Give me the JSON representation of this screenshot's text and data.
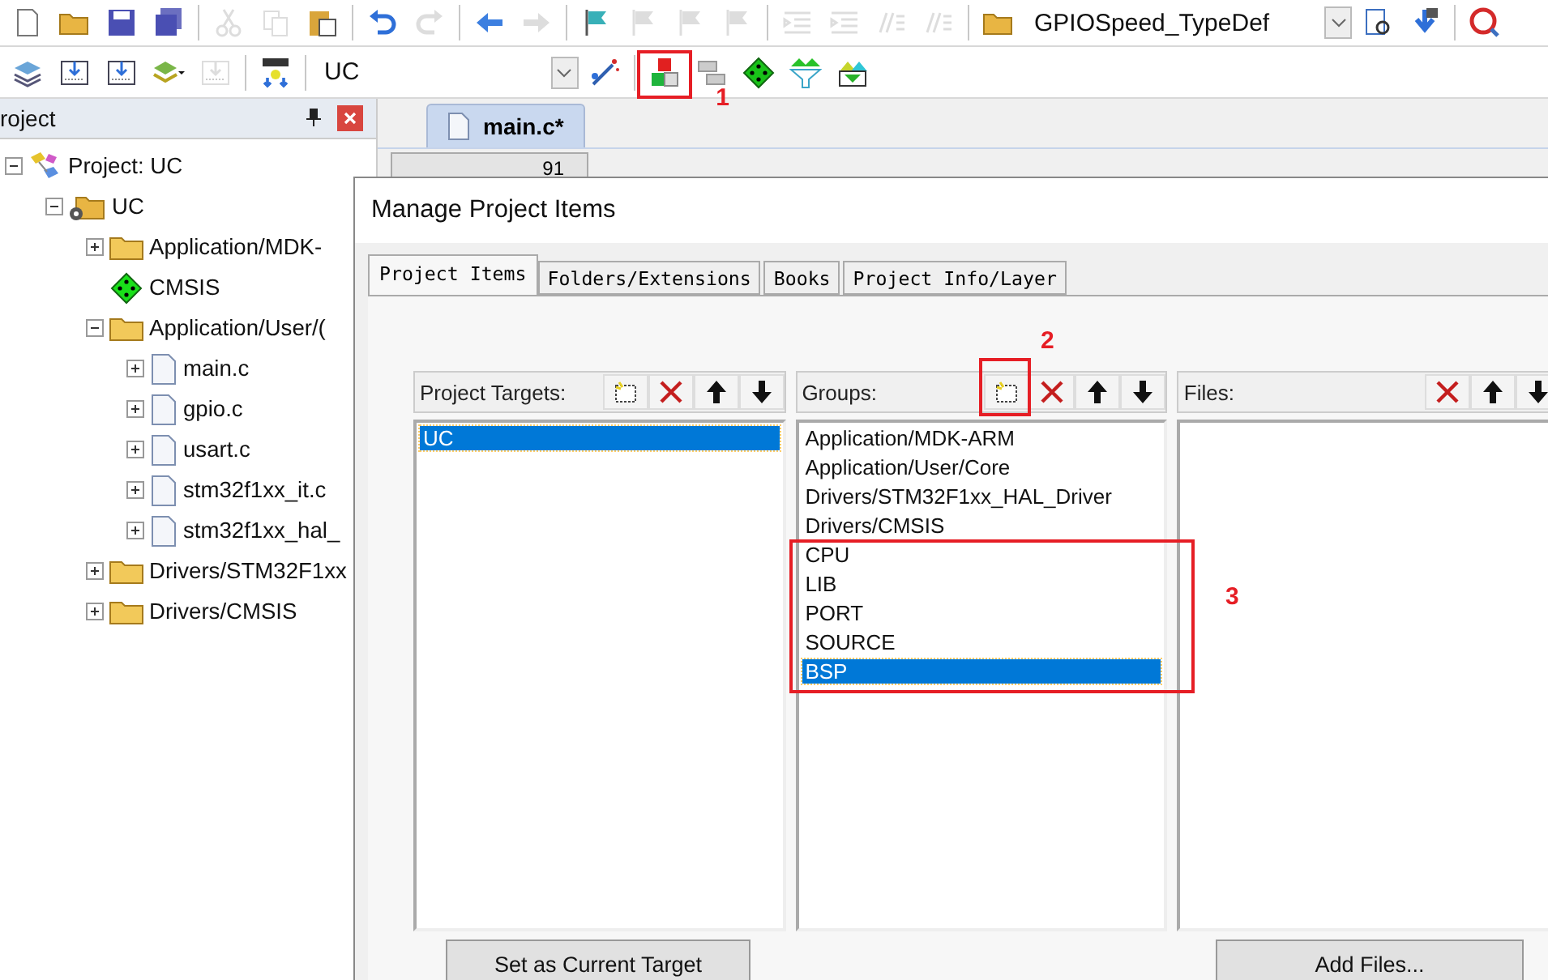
{
  "toolbar_1": {
    "buttons": [
      {
        "disabled": false
      },
      {
        "disabled": false
      },
      {
        "disabled": false
      },
      {
        "disabled": false
      },
      {
        "disabled": true
      },
      {
        "disabled": true
      },
      {
        "disabled": false
      },
      {
        "disabled": false
      },
      {
        "disabled": true
      },
      {
        "disabled": false
      },
      {
        "disabled": true
      },
      {
        "disabled": false
      },
      {
        "disabled": true
      },
      {
        "disabled": true
      },
      {
        "disabled": true
      },
      {
        "disabled": true
      },
      {
        "disabled": true
      },
      {
        "disabled": true
      },
      {
        "disabled": true
      },
      {
        "disabled": false
      }
    ],
    "combo": {
      "value": "GPIOSpeed_TypeDef"
    },
    "buttons_after": [
      {
        "disabled": false
      },
      {
        "disabled": false
      },
      {
        "disabled": false
      }
    ]
  },
  "toolbar_2": {
    "buttons": [
      {
        "disabled": false
      },
      {
        "disabled": false
      },
      {
        "disabled": false
      },
      {
        "disabled": false
      },
      {
        "disabled": true
      },
      {
        "disabled": false
      }
    ],
    "combo": {
      "value": "UC"
    },
    "buttons_after": [
      {
        "disabled": false
      },
      {
        "disabled": false
      },
      {
        "disabled": false
      },
      {
        "disabled": false
      },
      {
        "disabled": false
      },
      {
        "disabled": false
      }
    ]
  },
  "project_panel": {
    "title": "roject",
    "tree": [
      {
        "label": "Project: UC",
        "kind": "project",
        "expanded": true,
        "children": [
          {
            "label": "UC",
            "kind": "target",
            "expanded": true,
            "children": [
              {
                "label": "Application/MDK-",
                "kind": "group",
                "expanded": false
              },
              {
                "label": "CMSIS",
                "kind": "component"
              },
              {
                "label": "Application/User/(",
                "kind": "group",
                "expanded": true,
                "children": [
                  {
                    "label": "main.c",
                    "kind": "file",
                    "expanded": false
                  },
                  {
                    "label": "gpio.c",
                    "kind": "file",
                    "expanded": false
                  },
                  {
                    "label": "usart.c",
                    "kind": "file",
                    "expanded": false
                  },
                  {
                    "label": "stm32f1xx_it.c",
                    "kind": "file",
                    "expanded": false
                  },
                  {
                    "label": "stm32f1xx_hal_",
                    "kind": "file",
                    "expanded": false
                  }
                ]
              },
              {
                "label": "Drivers/STM32F1xx",
                "kind": "group",
                "expanded": false
              },
              {
                "label": "Drivers/CMSIS",
                "kind": "group",
                "expanded": false
              }
            ]
          }
        ]
      }
    ]
  },
  "editor": {
    "tabs": [
      {
        "label": "main.c*",
        "selected": true
      }
    ],
    "line_number": "91"
  },
  "dialog": {
    "title": "Manage Project Items",
    "tabs": [
      {
        "label": "Project Items",
        "selected": true
      },
      {
        "label": "Folders/Extensions",
        "selected": false
      },
      {
        "label": "Books",
        "selected": false
      },
      {
        "label": "Project Info/Layer",
        "selected": false
      }
    ],
    "targets": {
      "label": "Project Targets:",
      "items": [
        {
          "label": "UC",
          "selected": true
        }
      ]
    },
    "groups": {
      "label": "Groups:",
      "items": [
        {
          "label": "Application/MDK-ARM",
          "selected": false
        },
        {
          "label": "Application/User/Core",
          "selected": false
        },
        {
          "label": "Drivers/STM32F1xx_HAL_Driver",
          "selected": false
        },
        {
          "label": "Drivers/CMSIS",
          "selected": false
        },
        {
          "label": "CPU",
          "selected": false
        },
        {
          "label": "LIB",
          "selected": false
        },
        {
          "label": "PORT",
          "selected": false
        },
        {
          "label": "SOURCE",
          "selected": false
        },
        {
          "label": "BSP",
          "selected": true
        }
      ]
    },
    "files": {
      "label": "Files:"
    },
    "buttons": [
      "Set as Current Target",
      "Add Files..."
    ]
  },
  "annotations": [
    {
      "label": "1"
    },
    {
      "label": "2"
    },
    {
      "label": "3"
    }
  ]
}
